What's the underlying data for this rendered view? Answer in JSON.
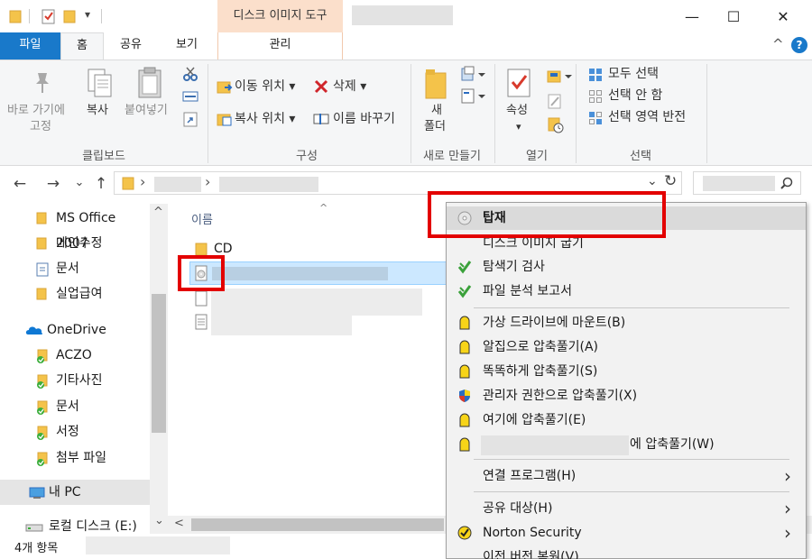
{
  "titlebar": {
    "qat_dropdown": "▾",
    "context_tab_header": "디스크 이미지 도구",
    "minimize": "—",
    "maximize": "☐",
    "close": "✕"
  },
  "ribbon_tabs": {
    "file": "파일",
    "home": "홈",
    "share": "공유",
    "view": "보기",
    "manage": "관리",
    "collapse": "^",
    "help": "?"
  },
  "ribbon": {
    "clipboard": {
      "pin_line1": "바로 가기에",
      "pin_line2": "고정",
      "copy": "복사",
      "paste": "붙여넣기",
      "group_label": "클립보드"
    },
    "organize": {
      "move_to": "이동 위치 ▾",
      "copy_to": "복사 위치 ▾",
      "delete": "삭제 ▾",
      "rename": "이름 바꾸기",
      "group_label": "구성"
    },
    "new": {
      "new_folder_line1": "새",
      "new_folder_line2": "폴더",
      "group_label": "새로 만들기"
    },
    "open": {
      "properties": "속성",
      "properties_arrow": "▾",
      "group_label": "열기"
    },
    "select": {
      "select_all": "모두 선택",
      "select_none": "선택 안 함",
      "invert": "선택 영역 반전",
      "group_label": "선택"
    }
  },
  "addressbar": {
    "back": "←",
    "forward": "→",
    "recent": "⌄",
    "up": "↑",
    "chevron": "›",
    "dropdown": "⌄",
    "refresh": "↻"
  },
  "navpane": {
    "items": [
      {
        "label": "MS Office 2007",
        "icon": "folder-icon"
      },
      {
        "label": "메인수정",
        "icon": "folder-icon"
      },
      {
        "label": "문서",
        "icon": "document-folder-icon"
      },
      {
        "label": "실업급여",
        "icon": "folder-icon"
      },
      {
        "label": "OneDrive",
        "icon": "onedrive-icon"
      },
      {
        "label": "ACZO",
        "icon": "synced-folder-icon"
      },
      {
        "label": "기타사진",
        "icon": "synced-folder-icon"
      },
      {
        "label": "문서",
        "icon": "synced-folder-icon"
      },
      {
        "label": "서정",
        "icon": "synced-folder-icon"
      },
      {
        "label": "첨부 파일",
        "icon": "synced-folder-icon"
      },
      {
        "label": "내 PC",
        "icon": "pc-icon"
      },
      {
        "label": "로컬 디스크 (E:)",
        "icon": "drive-icon"
      }
    ],
    "scroll_up": "^",
    "scroll_down": "⌄"
  },
  "content": {
    "sort_indicator": "^",
    "column_name": "이름",
    "files": [
      {
        "name": "CD",
        "icon": "folder-icon"
      }
    ],
    "scroll_left": "<"
  },
  "statusbar": {
    "item_count": "4개 항목"
  },
  "context_menu": {
    "items": [
      {
        "label": "탑재",
        "bold": true
      },
      {
        "label": "디스크 이미지 굽기"
      },
      {
        "label": "탐색기 검사"
      },
      {
        "label": "파일 분석 보고서"
      },
      {
        "label": "가상 드라이브에 마운트(B)"
      },
      {
        "label": "알집으로 압축풀기(A)"
      },
      {
        "label": "똑똑하게 압축풀기(S)"
      },
      {
        "label": "관리자 권한으로 압축풀기(X)"
      },
      {
        "label": "여기에 압축풀기(E)"
      },
      {
        "label": "에 압축풀기(W)"
      },
      {
        "label": "연결 프로그램(H)",
        "submenu": true
      },
      {
        "label": "공유 대상(H)",
        "submenu": true
      },
      {
        "label": "Norton Security",
        "submenu": true
      },
      {
        "label": "이전 버전 복원(V)"
      }
    ],
    "submenu_arrow": "›"
  },
  "colors": {
    "file_tab": "#1979ca",
    "context_tab": "#fbdfcb",
    "selection": "#cce8ff",
    "highlight": "#e30000",
    "folder": "#f4c34a"
  }
}
